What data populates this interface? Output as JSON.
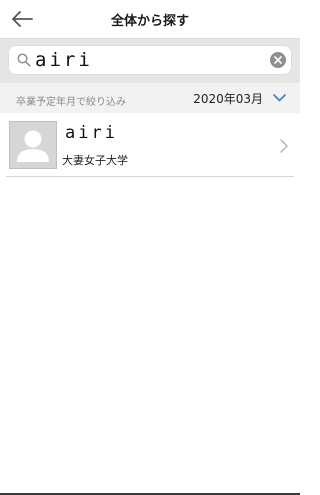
{
  "nav": {
    "title": "全体から探す",
    "back_icon": "arrow-left-icon"
  },
  "search": {
    "value": "airi",
    "icon": "search-icon",
    "clear_icon": "clear-icon"
  },
  "filter": {
    "label": "卒業予定年月で絞り込み",
    "selected_value": "2020年03月",
    "chevron_icon": "chevron-down-icon",
    "accent_color": "#3a7fc1"
  },
  "results": [
    {
      "name": "airi",
      "school": "大妻女子大学",
      "avatar_icon": "avatar-placeholder-icon",
      "chevron_icon": "chevron-right-icon"
    }
  ],
  "colors": {
    "search_background": "#e6e6e6",
    "filter_background": "#f2f2f2",
    "avatar_background": "#d6d6d6"
  }
}
